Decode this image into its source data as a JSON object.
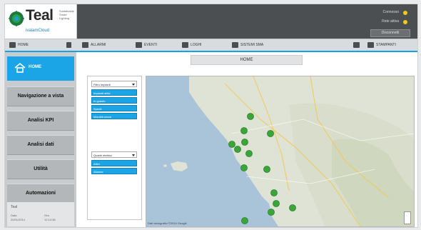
{
  "brand": {
    "name": "Teal",
    "tagline": [
      "Sustainable",
      "Smart",
      "Lighting"
    ],
    "sub": "ivalamCloud"
  },
  "header_status": {
    "lines": [
      {
        "label": "Connesso"
      },
      {
        "label": "Rete attiva"
      }
    ],
    "button_label": "Disconnetti"
  },
  "toolbar": {
    "items": [
      {
        "label": "HOME",
        "icon": "home-icon"
      },
      {
        "label": "ALLARMI",
        "icon": "alarm-icon"
      },
      {
        "label": "EVENTI",
        "icon": "events-icon"
      },
      {
        "label": "LOGHI",
        "icon": "chart-icon"
      },
      {
        "label": "SISTEMI SMA",
        "icon": "network-icon"
      }
    ],
    "right_items": [
      {
        "label": "",
        "icon": "speaker-icon"
      },
      {
        "label": "STAMPANTI",
        "icon": "printer-icon"
      }
    ]
  },
  "sidebar": {
    "home_label": "HOME",
    "items": [
      {
        "label": "Navigazione a vista"
      },
      {
        "label": "Analisi KPI"
      },
      {
        "label": "Analisi dati"
      },
      {
        "label": "Utilità"
      },
      {
        "label": "Automazioni"
      }
    ],
    "footer": {
      "title": "Teal",
      "col1_label": "Data",
      "col1_value": "20/01/2014",
      "col2_label": "Ora",
      "col2_value": "12:14:38"
    }
  },
  "main": {
    "page_title": "HOME",
    "filter1_placeholder": "Filtro impianti",
    "filter1_options": [
      "Impianti attivi",
      "In guasto",
      "Spenti",
      "Manutenzione"
    ],
    "filter2_placeholder": "Quadri elettrici",
    "filter2_options": [
      "Attivi",
      "Allarme"
    ],
    "map_credit": "Dati cartografici ©2014 Google",
    "marker_color": "#3aa63a"
  },
  "colors": {
    "accent": "#1ba5e6",
    "header_bg": "#4b4f52",
    "status_dot": "#f0cc1a"
  }
}
